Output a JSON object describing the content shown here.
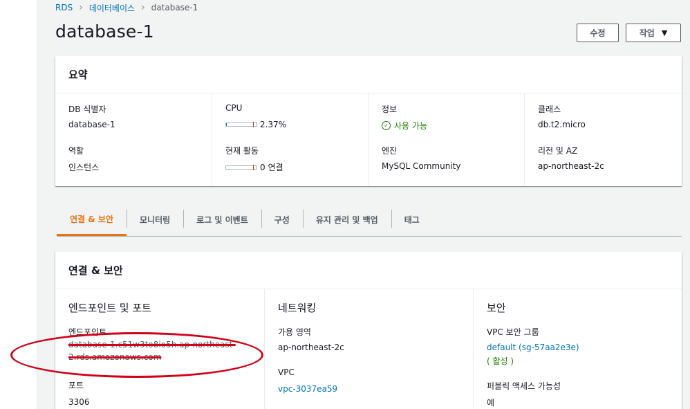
{
  "breadcrumb": {
    "root": "RDS",
    "section": "데이터베이스",
    "current": "database-1"
  },
  "page": {
    "title": "database-1"
  },
  "header_buttons": {
    "edit": "수정",
    "actions": "작업"
  },
  "summary": {
    "title": "요약",
    "identifier_label": "DB 식별자",
    "identifier_value": "database-1",
    "role_label": "역할",
    "role_value": "인스턴스",
    "cpu_label": "CPU",
    "cpu_value": "2.37%",
    "cpu_fraction": 0.0237,
    "activity_label": "현재 활동",
    "activity_value": "0 연결",
    "info_label": "정보",
    "info_value": "사용 가능",
    "engine_label": "엔진",
    "engine_value": "MySQL Community",
    "class_label": "클래스",
    "class_value": "db.t2.micro",
    "region_label": "리전 및 AZ",
    "region_value": "ap-northeast-2c"
  },
  "tabs": [
    {
      "label": "연결 & 보안",
      "active": true
    },
    {
      "label": "모니터링"
    },
    {
      "label": "로그 및 이벤트"
    },
    {
      "label": "구성"
    },
    {
      "label": "유지 관리 및 백업"
    },
    {
      "label": "태그"
    }
  ],
  "connectivity": {
    "title": "연결 & 보안",
    "endpoint_section": "엔드포인트 및 포트",
    "endpoint_label": "엔드포인트",
    "endpoint_line1": "database-1.c51w3to8io5h.ap-northeast-",
    "endpoint_line2": "2.rds.amazonaws.com",
    "port_label": "포트",
    "port_value": "3306",
    "network_section": "네트워킹",
    "az_label": "가용 영역",
    "az_value": "ap-northeast-2c",
    "vpc_label": "VPC",
    "vpc_value": "vpc-3037ea59",
    "security_section": "보안",
    "sg_label": "VPC 보안 그룹",
    "sg_value": "default (sg-57aa2e3e)",
    "sg_status": "( 활성 )",
    "public_label": "퍼블릭 액세스 가능성",
    "public_value": "예"
  },
  "colors": {
    "link": "#0073bb",
    "accent": "#ec7211",
    "success": "#1d8102",
    "annotation": "#d0021b"
  }
}
